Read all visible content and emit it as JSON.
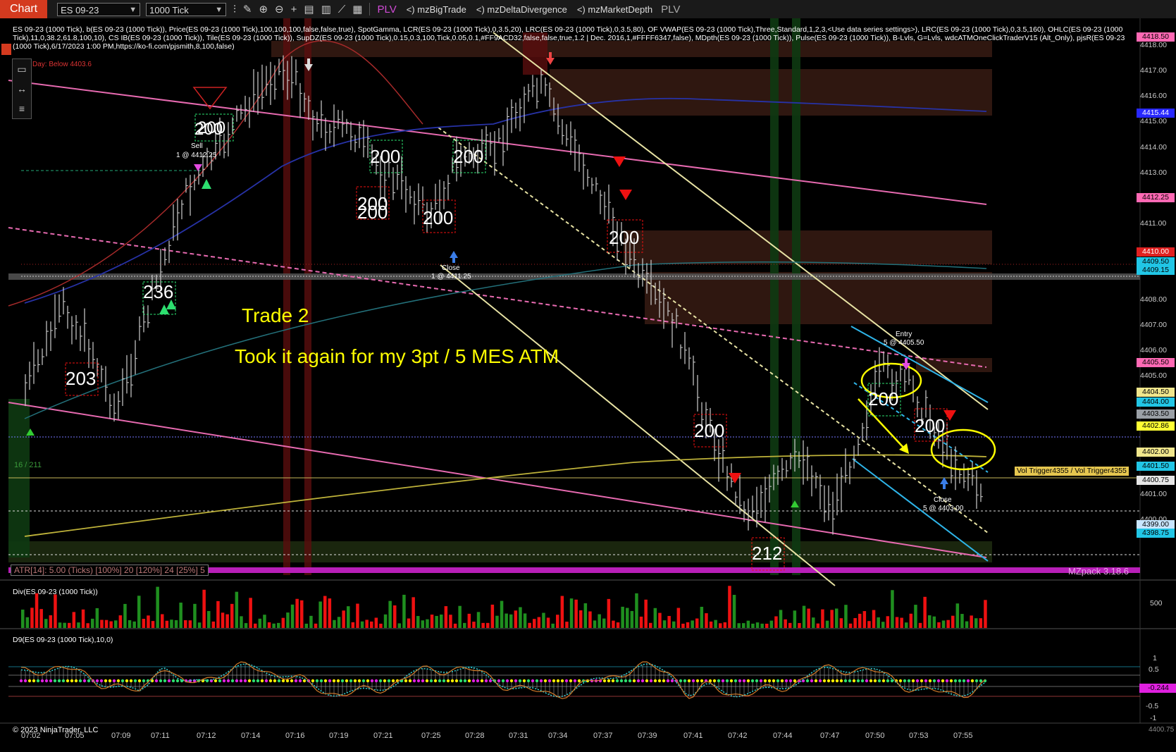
{
  "toolbar": {
    "tab": "Chart",
    "instrument": "ES 09-23",
    "interval": "1000 Tick",
    "plv_left": "PLV",
    "indicators": [
      "<) mzBigTrade",
      "<) mzDeltaDivergence",
      "<) mzMarketDepth"
    ],
    "plv_right": "PLV"
  },
  "indicator_line": "ES 09-23 (1000 Tick), b(ES 09-23 (1000 Tick)), Price(ES 09-23 (1000 Tick),100,100,100,false,false,true), SpotGamma, LCR(ES 09-23 (1000 Tick),0,3.5,20), LRC(ES 09-23 (1000 Tick),0,3.5,80), OF VWAP(ES 09-23 (1000 Tick),Three,Standard,1,2,3,<Use data series settings>), LRC(ES 09-23 (1000 Tick),0,3.5,160), OHLC(ES 09-23 (1000 Tick),11,0,38.2,61.8,100,10), CS IB(ES 09-23 (1000 Tick)), Tile(ES 09-23 (1000 Tick)), SupDZ(ES 09-23 (1000 Tick),0.15,0.3,100,Tick,0.05,0.1,#FF9ACD32,false,false,true,1.2 | Dec. 2016,1,#FFFF6347,false), MDpth(ES 09-23 (1000 Tick)), Pulse(ES 09-23 (1000 Tick)), B-Lvls, G=Lvls, wdcATMOneClickTraderV15 (Alt_Only), pjsR(ES 09-23 (1000 Tick),6/17/2023 1:00 PM,https://ko-fi.com/pjsmith,8,100,false)",
  "annotations": {
    "day_below": "Day: Below 4403.6",
    "trade_title": "Trade 2",
    "trade_text": "Took it again for my 3pt / 5 MES ATM",
    "counter": "16 / 211",
    "atr": "ATR[14]: 5.00 (Ticks) [100%] 20  [120%] 24  [25%] 5",
    "mzpack": "MZpack 3.18.6",
    "vol_trigger": "Vol Trigger4355 / Vol Trigger4355"
  },
  "orders": {
    "sell": [
      "Sell",
      "1 @ 4412.25"
    ],
    "close1": [
      "Close",
      "1 @ 4411.25"
    ],
    "entry": [
      "Entry",
      "5 @ 4405.50"
    ],
    "close2": [
      "Close",
      "5 @ 4403.00"
    ]
  },
  "boxes": [
    "200",
    "200",
    "200",
    "200",
    "200",
    "200",
    "236",
    "200",
    "203",
    "200",
    "200",
    "212",
    "200"
  ],
  "price_tags": [
    {
      "text": "4418.50",
      "bg": "#ff69b4"
    },
    {
      "text": "4415.44",
      "bg": "#2828ff",
      "fg": "#fff"
    },
    {
      "text": "4412.25",
      "bg": "#ff69b4"
    },
    {
      "text": "4410.00",
      "bg": "#e02020",
      "fg": "#fff"
    },
    {
      "text": "4409.50",
      "bg": "#21c6e6"
    },
    {
      "text": "4409.15",
      "bg": "#21c6e6"
    },
    {
      "text": "4405.50",
      "bg": "#ff69b4"
    },
    {
      "text": "4404.50",
      "bg": "#f0e68c"
    },
    {
      "text": "4404.00",
      "bg": "#21c6e6"
    },
    {
      "text": "4403.50",
      "bg": "#9aa0a6"
    },
    {
      "text": "4402.86",
      "bg": "#ffff33"
    },
    {
      "text": "4402.00",
      "bg": "#f0e68c"
    },
    {
      "text": "4401.50",
      "bg": "#21c6e6"
    },
    {
      "text": "4400.75",
      "bg": "#e6e6e6"
    },
    {
      "text": "4399.00",
      "bg": "#c8e6ff"
    },
    {
      "text": "4398.75",
      "bg": "#21c6e6"
    }
  ],
  "price_axis": [
    "4418.00",
    "4417.00",
    "4416.00",
    "4415.00",
    "4414.00",
    "4413.00",
    "4411.00",
    "4408.00",
    "4407.00",
    "4406.00",
    "4405.00",
    "4401.00",
    "4400.00"
  ],
  "panel2": {
    "title": "Div(ES 09-23 (1000 Tick))",
    "axis": "500"
  },
  "panel3": {
    "title": "D9(ES 09-23 (1000 Tick),10,0)",
    "axis": [
      "1",
      "0.5",
      "-0.5",
      "-1"
    ],
    "tag": "-0.244",
    "bottom": "4400.75"
  },
  "copyright": "© 2023 NinjaTrader, LLC",
  "time_axis": [
    "07:02",
    "07:05",
    "07:09",
    "07:11",
    "07:12",
    "07:14",
    "07:16",
    "07:19",
    "07:21",
    "07:25",
    "07:28",
    "07:31",
    "07:34",
    "07:37",
    "07:39",
    "07:41",
    "07:42",
    "07:44",
    "07:47",
    "07:50",
    "07:53",
    "07:55"
  ],
  "colors": {
    "tab": "#d43a1f",
    "plv": "#d04bd6",
    "annotation": "#ffff00",
    "bull": "#1f8f1f",
    "bear": "#e11",
    "pink": "#ff69b4"
  }
}
